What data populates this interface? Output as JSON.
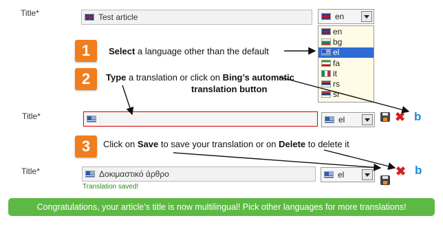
{
  "row1": {
    "label": "Title*",
    "field_value": "Test article",
    "field_flag": "uk-flag",
    "language_value": "en",
    "language_flag": "uk-flag"
  },
  "dropdown": {
    "options": [
      {
        "code": "en",
        "flag": "uk-flag"
      },
      {
        "code": "bg",
        "flag": "bulgaria-flag"
      },
      {
        "code": "el",
        "flag": "greece-flag"
      },
      {
        "code": "fa",
        "flag": "iran-flag"
      },
      {
        "code": "it",
        "flag": "italy-flag"
      },
      {
        "code": "rs",
        "flag": "serbia-flag"
      },
      {
        "code": "sr",
        "flag": "serbia-flag"
      }
    ],
    "selected": "el"
  },
  "steps": {
    "step1": {
      "number": "1",
      "bold": "Select",
      "text": " a language other than the default"
    },
    "step2": {
      "number": "2",
      "bold1": "Type",
      "text1": " a translation or click on ",
      "bold2": "Bing’s automatic",
      "bold3": "translation button"
    },
    "step3": {
      "number": "3",
      "text1": "Click on ",
      "bold1": "Save",
      "text2": " to save your translation or on ",
      "bold2": "Delete",
      "text3": " to delete it"
    }
  },
  "row2": {
    "label": "Title*",
    "field_value": "",
    "field_flag": "greece-flag",
    "language_value": "el",
    "language_flag": "greece-flag"
  },
  "row3": {
    "label": "Title*",
    "field_value": "Δοκιμαστικό άρθρο",
    "field_flag": "greece-flag",
    "language_value": "el",
    "language_flag": "greece-flag",
    "status": "Translation saved!"
  },
  "actions": {
    "save_icon": "save-disk-icon",
    "delete_icon": "delete-x-icon",
    "bing_icon": "bing-b-icon"
  },
  "banner": {
    "text": "Congratulations, your article’s title is now multilingual! Pick other languages for more translations!"
  },
  "colors": {
    "step_badge": "#f07e1e",
    "banner": "#5db944",
    "selected_option": "#2e6bd6",
    "error_border": "#d40000",
    "saved_text": "#2d8a18"
  }
}
